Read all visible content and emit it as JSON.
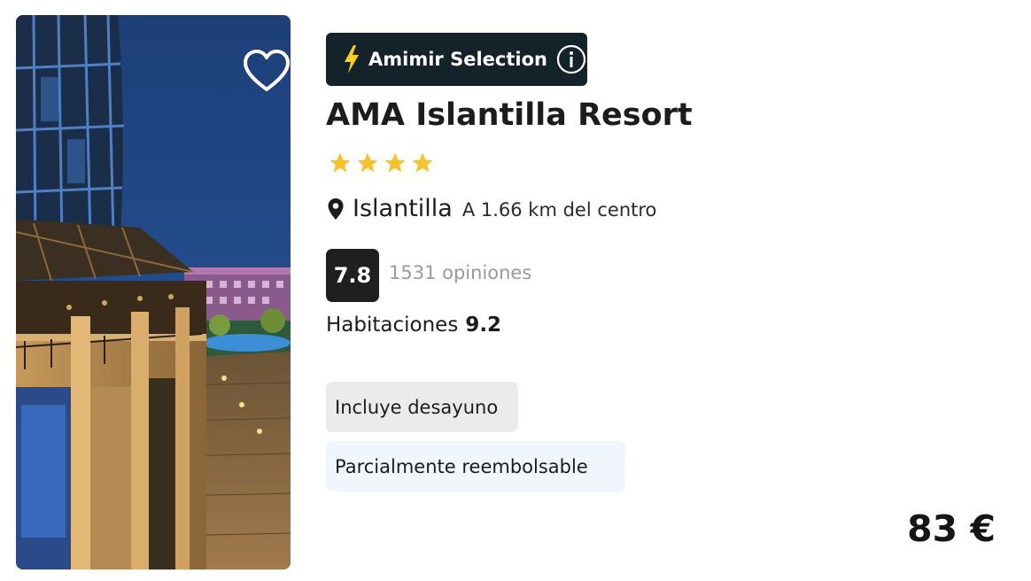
{
  "hotel": {
    "name": "AMA Islantilla Resort",
    "star_rating": 4,
    "city": "Islantilla",
    "distance": "A 1.66 km del centro"
  },
  "badge": {
    "label": "Amimir Selection",
    "icon_left": "lightning-bolt-icon",
    "icon_right": "info-icon",
    "bg_color": "#14222a",
    "bolt_color": "#f5d020"
  },
  "rating": {
    "score": "7.8",
    "reviews": "1531 opiniones"
  },
  "rooms": {
    "label": "Habitaciones",
    "value": "9.2"
  },
  "tags": {
    "breakfast": "Incluye desayuno",
    "refund": "Parcialmente reembolsable"
  },
  "price": "83 €",
  "colors": {
    "star": "#f4c430",
    "score_bg": "#1f1f1f",
    "breakfast_chip": "#ebebeb",
    "refund_chip": "#f1f5fc"
  },
  "icons": {
    "favorite": "heart-outline-icon",
    "location": "map-pin-icon",
    "star": "star-icon"
  }
}
